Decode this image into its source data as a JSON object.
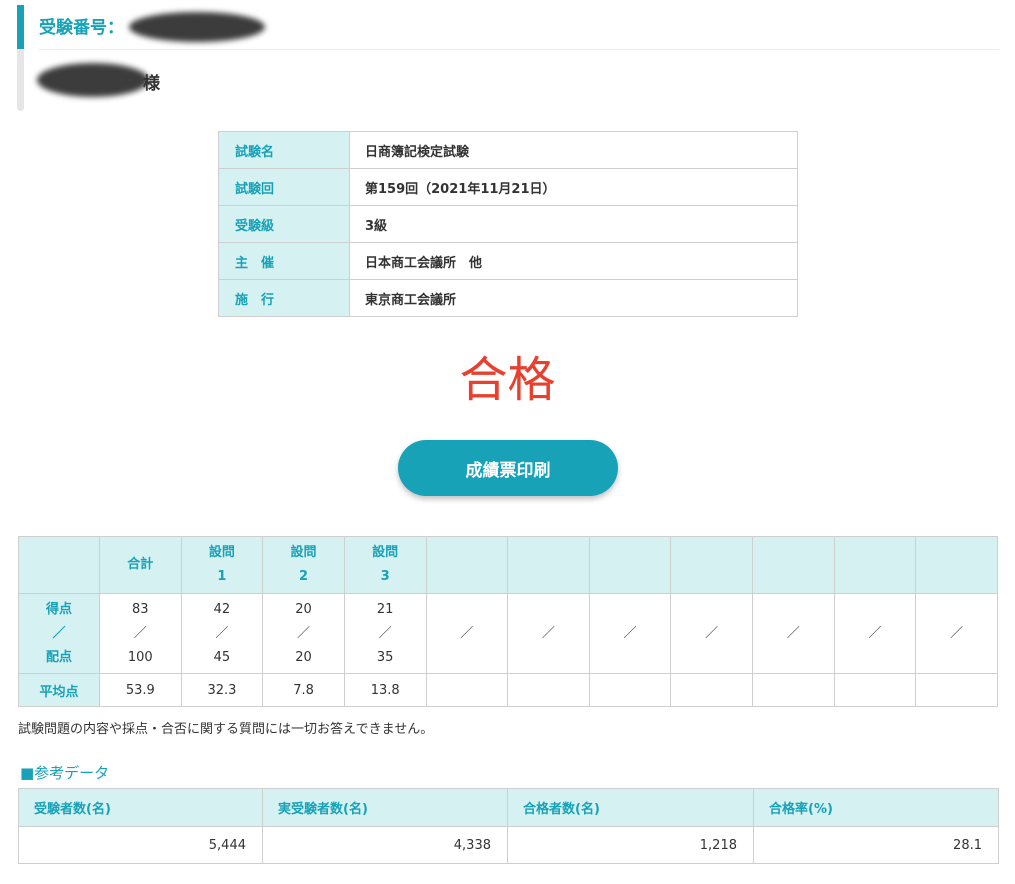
{
  "header": {
    "exam_number_label": "受験番号：",
    "honorific": "様"
  },
  "exam_info": [
    {
      "label": "試験名",
      "value": "日商簿記検定試験"
    },
    {
      "label": "試験回",
      "value": "第159回（2021年11月21日）"
    },
    {
      "label": "受験級",
      "value": "3級"
    },
    {
      "label": "主　催",
      "value": "日本商工会議所　他"
    },
    {
      "label": "施　行",
      "value": "東京商工会議所"
    }
  ],
  "result": "合格",
  "print_button": "成績票印刷",
  "scores": {
    "columns": [
      {
        "line1": "合計",
        "line2": ""
      },
      {
        "line1": "設問",
        "line2": "1"
      },
      {
        "line1": "設問",
        "line2": "2"
      },
      {
        "line1": "設問",
        "line2": "3"
      }
    ],
    "row_score_label": [
      "得点",
      "／",
      "配点"
    ],
    "score_cells": [
      {
        "score": "83",
        "sep": "／",
        "max": "100"
      },
      {
        "score": "42",
        "sep": "／",
        "max": "45"
      },
      {
        "score": "20",
        "sep": "／",
        "max": "20"
      },
      {
        "score": "21",
        "sep": "／",
        "max": "35"
      }
    ],
    "empty_separator": "／",
    "row_avg_label": "平均点",
    "averages": [
      "53.9",
      "32.3",
      "7.8",
      "13.8"
    ]
  },
  "notice": "試験問題の内容や採点・合否に関する質問には一切お答えできません。",
  "reference": {
    "title": "■参考データ",
    "headers": [
      "受験者数(名)",
      "実受験者数(名)",
      "合格者数(名)",
      "合格率(%)"
    ],
    "values": [
      "5,444",
      "4,338",
      "1,218",
      "28.1"
    ]
  },
  "colors": {
    "accent": "#17a2b8",
    "header_bg": "#d5f1f1",
    "pass": "#e8402e"
  }
}
